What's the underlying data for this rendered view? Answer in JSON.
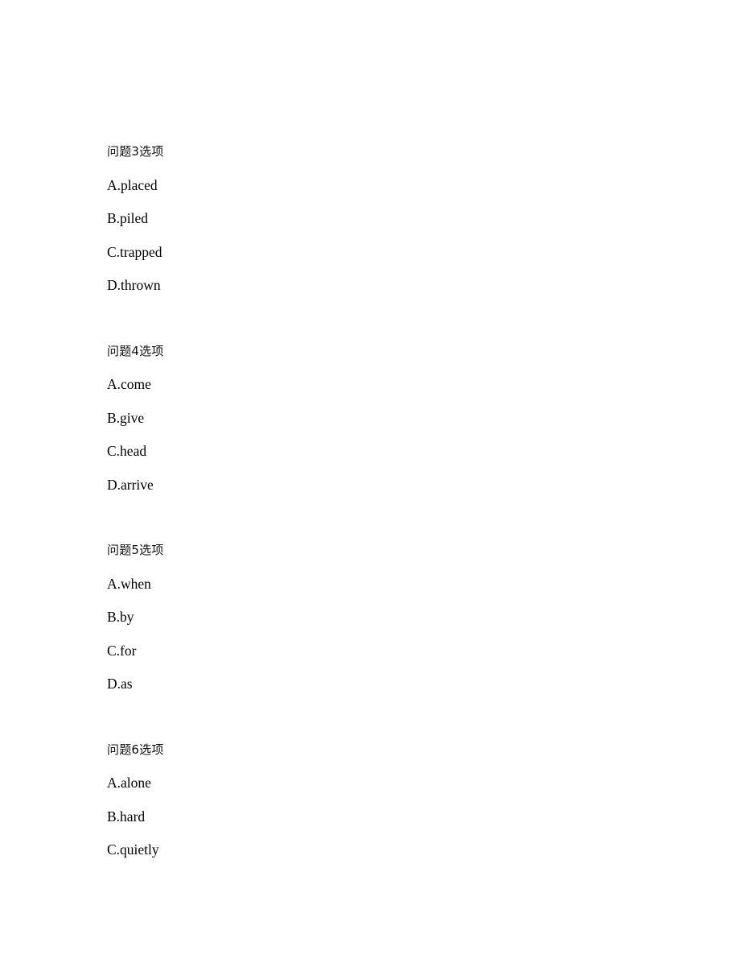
{
  "document": {
    "page_background": "#ffffff",
    "text_color": "#000000",
    "blocks": [
      {
        "heading": "问题3选项",
        "options": [
          "A.placed",
          "B.piled",
          "C.trapped",
          "D.thrown"
        ]
      },
      {
        "heading": "问题4选项",
        "options": [
          "A.come",
          "B.give",
          "C.head",
          "D.arrive"
        ]
      },
      {
        "heading": "问题5选项",
        "options": [
          "A.when",
          "B.by",
          "C.for",
          "D.as"
        ]
      },
      {
        "heading": "问题6选项",
        "options": [
          "A.alone",
          "B.hard",
          "C.quietly"
        ]
      }
    ]
  }
}
